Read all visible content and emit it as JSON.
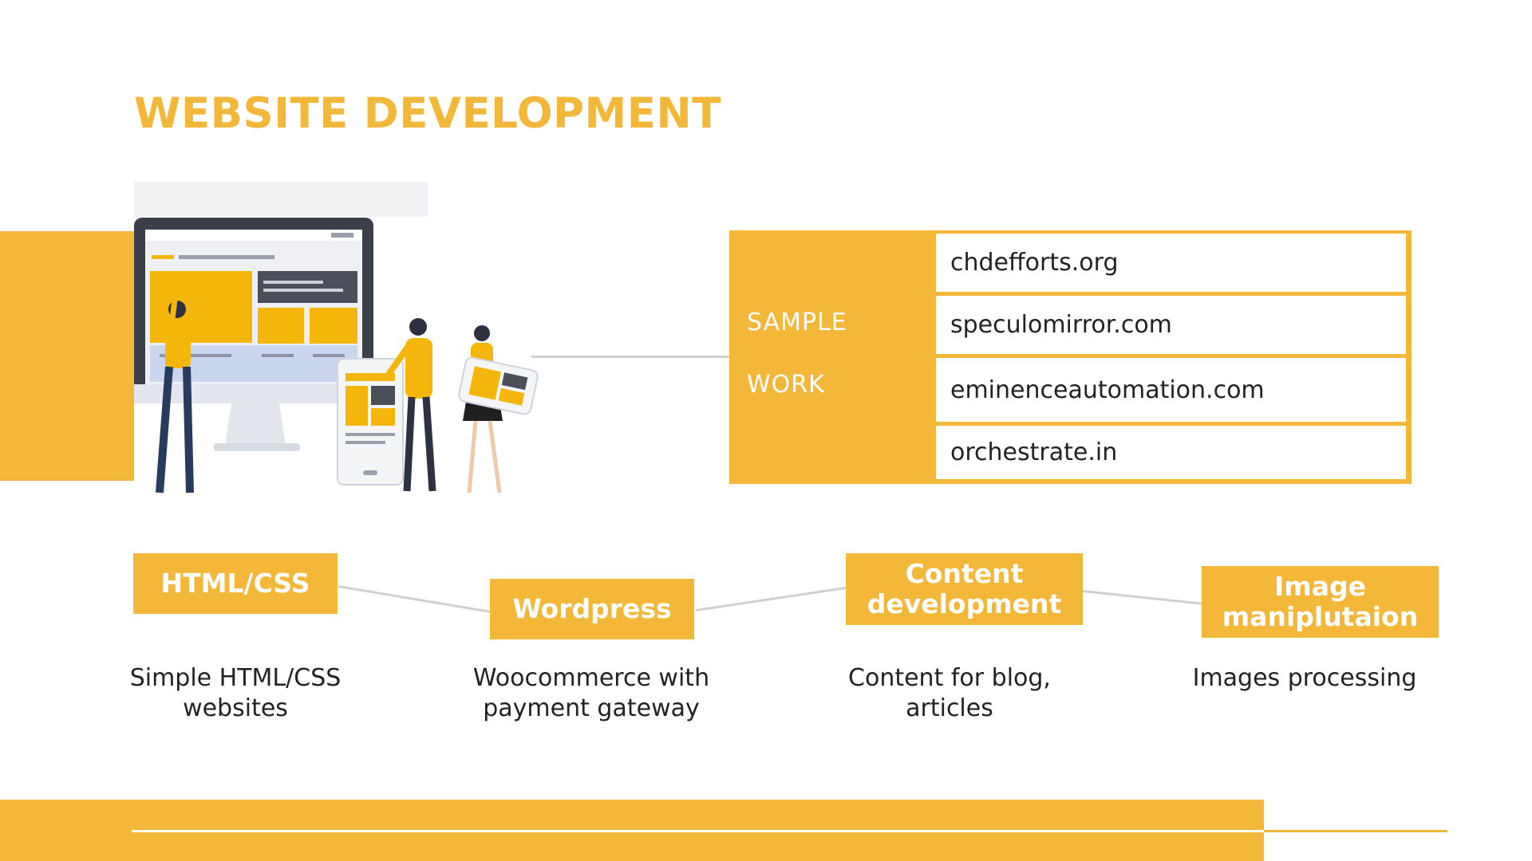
{
  "title": "WEBSITE DEVELOPMENT",
  "sample_work": {
    "label_line1": "SAMPLE",
    "label_line2": "WORK",
    "sites": [
      "chdefforts.org",
      "speculomirror.com",
      "eminenceautomation.com",
      "orchestrate.in"
    ]
  },
  "skills": [
    {
      "name": "HTML/CSS",
      "description": "Simple HTML/CSS websites"
    },
    {
      "name": "Wordpress",
      "description": "Woocommerce with payment gateway"
    },
    {
      "name": "Content development",
      "description": "Content for blog, articles"
    },
    {
      "name": "Image maniplutaion",
      "description": "Images processing"
    }
  ],
  "colors": {
    "accent": "#f3b83a",
    "connector": "#d0d0d0",
    "text": "#222222"
  },
  "illustration": "website-development-illustration"
}
